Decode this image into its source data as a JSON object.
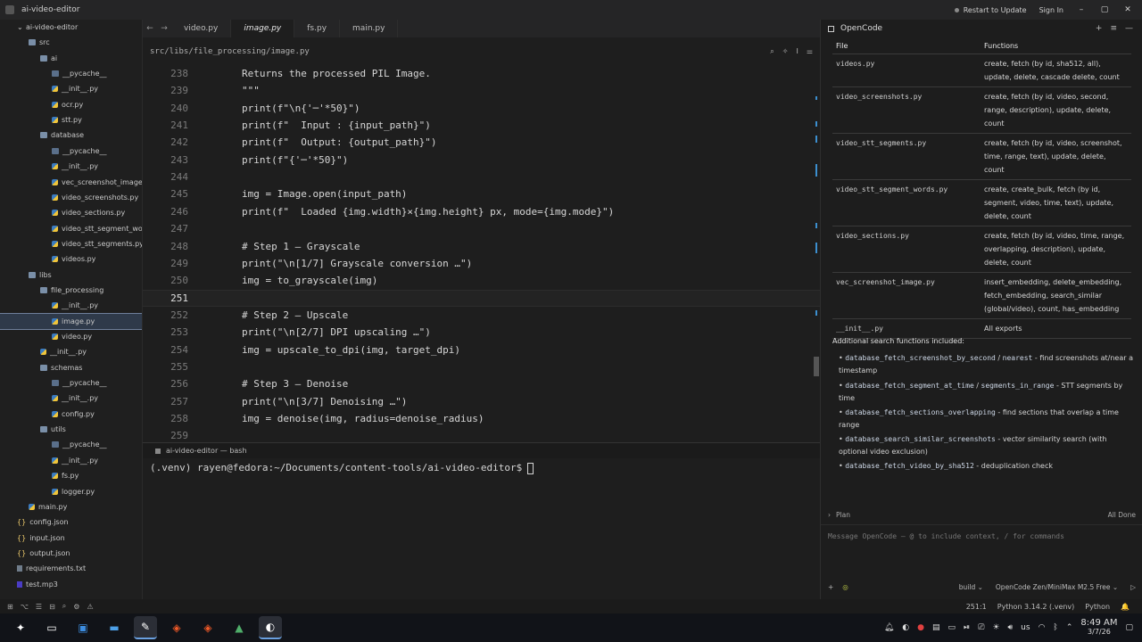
{
  "window": {
    "title": "ai-video-editor",
    "restart_label": "Restart to Update",
    "signin_label": "Sign In"
  },
  "sidebar": {
    "rows": [
      {
        "label": "ai-video-editor",
        "icon": "chevron-down-icon"
      },
      {
        "label": "src",
        "icon": "folder-open-icon"
      },
      {
        "label": "ai",
        "icon": "folder-open-icon"
      },
      {
        "label": "__pycache__",
        "icon": "folder-icon"
      },
      {
        "label": "__init__.py",
        "icon": "python-file-icon"
      },
      {
        "label": "ocr.py",
        "icon": "python-file-icon"
      },
      {
        "label": "stt.py",
        "icon": "python-file-icon"
      },
      {
        "label": "database",
        "icon": "folder-open-icon"
      },
      {
        "label": "__pycache__",
        "icon": "folder-icon"
      },
      {
        "label": "__init__.py",
        "icon": "python-file-icon"
      },
      {
        "label": "vec_screenshot_image.py",
        "icon": "python-file-icon"
      },
      {
        "label": "video_screenshots.py",
        "icon": "python-file-icon"
      },
      {
        "label": "video_sections.py",
        "icon": "python-file-icon"
      },
      {
        "label": "video_stt_segment_words.py",
        "icon": "python-file-icon"
      },
      {
        "label": "video_stt_segments.py",
        "icon": "python-file-icon"
      },
      {
        "label": "videos.py",
        "icon": "python-file-icon"
      },
      {
        "label": "libs",
        "icon": "folder-open-icon"
      },
      {
        "label": "file_processing",
        "icon": "folder-open-icon"
      },
      {
        "label": "__init__.py",
        "icon": "python-file-icon"
      },
      {
        "label": "image.py",
        "icon": "python-file-icon"
      },
      {
        "label": "video.py",
        "icon": "python-file-icon"
      },
      {
        "label": "__init__.py",
        "icon": "python-file-icon"
      },
      {
        "label": "schemas",
        "icon": "folder-open-icon"
      },
      {
        "label": "__pycache__",
        "icon": "folder-icon"
      },
      {
        "label": "__init__.py",
        "icon": "python-file-icon"
      },
      {
        "label": "config.py",
        "icon": "python-file-icon"
      },
      {
        "label": "utils",
        "icon": "folder-open-icon"
      },
      {
        "label": "__pycache__",
        "icon": "folder-icon"
      },
      {
        "label": "__init__.py",
        "icon": "python-file-icon"
      },
      {
        "label": "fs.py",
        "icon": "python-file-icon"
      },
      {
        "label": "logger.py",
        "icon": "python-file-icon"
      },
      {
        "label": "main.py",
        "icon": "python-file-icon"
      },
      {
        "label": "config.json",
        "icon": "json-file-icon"
      },
      {
        "label": "input.json",
        "icon": "json-file-icon"
      },
      {
        "label": "output.json",
        "icon": "json-file-icon"
      },
      {
        "label": "requirements.txt",
        "icon": "text-file-icon"
      },
      {
        "label": "test.mp3",
        "icon": "audio-file-icon"
      }
    ]
  },
  "tabs": [
    {
      "label": "video.py"
    },
    {
      "label": "image.py"
    },
    {
      "label": "fs.py"
    },
    {
      "label": "main.py"
    }
  ],
  "breadcrumb": "src/libs/file_processing/image.py",
  "code": {
    "lines": [
      {
        "n": "238",
        "text": "Returns the processed PIL Image."
      },
      {
        "n": "239",
        "text": "\"\"\""
      },
      {
        "n": "240",
        "text": "print(f\"\\n{'─'*50}\")"
      },
      {
        "n": "241",
        "text": "print(f\"  Input : {input_path}\")"
      },
      {
        "n": "242",
        "text": "print(f\"  Output: {output_path}\")"
      },
      {
        "n": "243",
        "text": "print(f\"{'─'*50}\")"
      },
      {
        "n": "244",
        "text": ""
      },
      {
        "n": "245",
        "text": "img = Image.open(input_path)"
      },
      {
        "n": "246",
        "text": "print(f\"  Loaded {img.width}×{img.height} px, mode={img.mode}\")"
      },
      {
        "n": "247",
        "text": ""
      },
      {
        "n": "248",
        "text": "# Step 1 – Grayscale"
      },
      {
        "n": "249",
        "text": "print(\"\\n[1/7] Grayscale conversion …\")"
      },
      {
        "n": "250",
        "text": "img = to_grayscale(img)"
      },
      {
        "n": "251",
        "text": ""
      },
      {
        "n": "252",
        "text": "# Step 2 – Upscale"
      },
      {
        "n": "253",
        "text": "print(\"\\n[2/7] DPI upscaling …\")"
      },
      {
        "n": "254",
        "text": "img = upscale_to_dpi(img, target_dpi)"
      },
      {
        "n": "255",
        "text": ""
      },
      {
        "n": "256",
        "text": "# Step 3 – Denoise"
      },
      {
        "n": "257",
        "text": "print(\"\\n[3/7] Denoising …\")"
      },
      {
        "n": "258",
        "text": "img = denoise(img, radius=denoise_radius)"
      },
      {
        "n": "259",
        "text": ""
      }
    ]
  },
  "terminal": {
    "tab_label": "ai-video-editor — bash",
    "prompt": "(.venv) rayen@fedora:~/Documents/content-tools/ai-video-editor$"
  },
  "opencode": {
    "title": "OpenCode",
    "table": {
      "headers": [
        "File",
        "Functions"
      ],
      "rows": [
        {
          "file": "videos.py",
          "functions": "create, fetch (by id, sha512, all), update, delete, cascade delete, count"
        },
        {
          "file": "video_screenshots.py",
          "functions": "create, fetch (by id, video, second, range, description), update, delete, count"
        },
        {
          "file": "video_stt_segments.py",
          "functions": "create, fetch (by id, video, screenshot, time, range, text), update, delete, count"
        },
        {
          "file": "video_stt_segment_words.py",
          "functions": "create, create_bulk, fetch (by id, segment, video, time, text), update, delete, count"
        },
        {
          "file": "video_sections.py",
          "functions": "create, fetch (by id, video, time, range, overlapping, description), update, delete, count"
        },
        {
          "file": "vec_screenshot_image.py",
          "functions": "insert_embedding, delete_embedding, fetch_embedding, search_similar (global/video), count, has_embedding"
        },
        {
          "file": "__init__.py",
          "functions": "All exports"
        }
      ]
    },
    "additional_heading": "Additional search functions included:",
    "bullets": [
      {
        "code": "database_fetch_screenshot_by_second",
        "sep": " / ",
        "code2": "nearest",
        "desc": " - find screenshots at/near a timestamp"
      },
      {
        "code": "database_fetch_segment_at_time",
        "sep": " / ",
        "code2": "segments_in_range",
        "desc": " - STT segments by time"
      },
      {
        "code": "database_fetch_sections_overlapping",
        "sep": "",
        "code2": "",
        "desc": " - find sections that overlap a time range"
      },
      {
        "code": "database_search_similar_screenshots",
        "sep": "",
        "code2": "",
        "desc": " - vector similarity search (with optional video exclusion)"
      },
      {
        "code": "database_fetch_video_by_sha512",
        "sep": "",
        "code2": "",
        "desc": " - deduplication check"
      }
    ],
    "plan_label": "Plan",
    "all_done_label": "All Done",
    "message_placeholder": "Message OpenCode — @ to include context, / for commands",
    "mode_label": "build",
    "model_label": "OpenCode Zen/MiniMax M2.5 Free"
  },
  "statusbar": {
    "position": "251:1",
    "interpreter": "Python 3.14.2 (.venv)",
    "language": "Python"
  },
  "taskbar": {
    "keyboard_layout": "us",
    "time": "8:49 AM",
    "date": "3/7/26"
  }
}
